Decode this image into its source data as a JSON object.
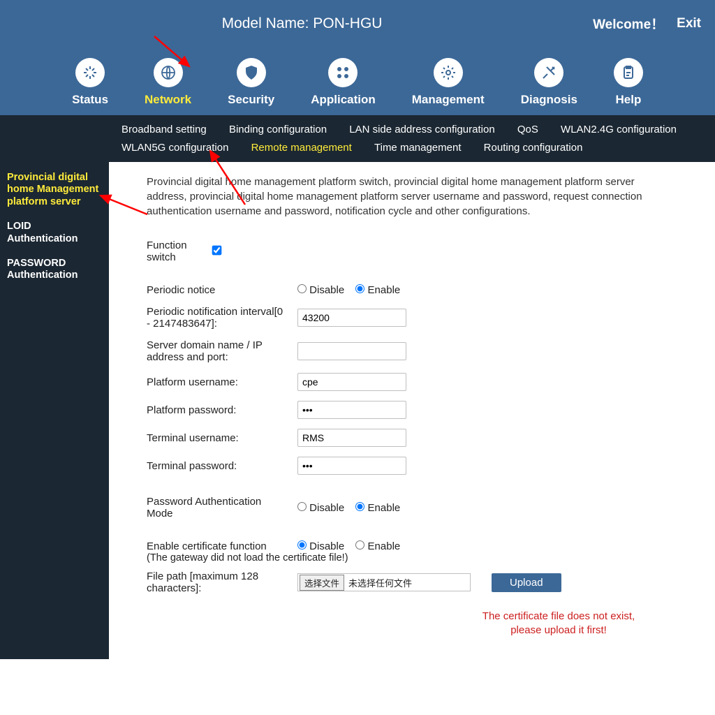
{
  "header": {
    "model_label": "Model Name: PON-HGU",
    "welcome": "Welcome！",
    "exit": "Exit"
  },
  "mainnav": [
    {
      "id": "status",
      "label": "Status"
    },
    {
      "id": "network",
      "label": "Network",
      "active": true
    },
    {
      "id": "security",
      "label": "Security"
    },
    {
      "id": "application",
      "label": "Application"
    },
    {
      "id": "management",
      "label": "Management"
    },
    {
      "id": "diagnosis",
      "label": "Diagnosis"
    },
    {
      "id": "help",
      "label": "Help"
    }
  ],
  "subnav": [
    {
      "label": "Broadband setting"
    },
    {
      "label": "Binding configuration"
    },
    {
      "label": "LAN side address configuration"
    },
    {
      "label": "QoS"
    },
    {
      "label": "WLAN2.4G configuration"
    },
    {
      "label": "WLAN5G configuration"
    },
    {
      "label": "Remote management",
      "active": true
    },
    {
      "label": "Time management"
    },
    {
      "label": "Routing configuration"
    }
  ],
  "sidebar": [
    {
      "label": "Provincial digital home Management platform server",
      "active": true
    },
    {
      "label": "LOID Authentication"
    },
    {
      "label": "PASSWORD Authentication"
    }
  ],
  "main": {
    "description": "Provincial digital home management platform switch, provincial digital home management platform server address, provincial digital home management platform server username and password, request connection authentication username and password, notification cycle and other configurations.",
    "function_switch_label": "Function switch",
    "function_switch_checked": true,
    "periodic_notice_label": "Periodic notice",
    "disable_text": "Disable",
    "enable_text": "Enable",
    "periodic_notice_value": "enable",
    "interval_label": "Periodic notification interval[0 - 2147483647]:",
    "interval_value": "43200",
    "server_label": "Server domain name / IP address and port:",
    "server_value": "",
    "platform_user_label": "Platform username:",
    "platform_user_value": "cpe",
    "platform_pass_label": "Platform password:",
    "platform_pass_value": "•••",
    "terminal_user_label": "Terminal username:",
    "terminal_user_value": "RMS",
    "terminal_pass_label": "Terminal password:",
    "terminal_pass_value": "•••",
    "pwd_auth_label": "Password Authentication Mode",
    "pwd_auth_value": "enable",
    "cert_label": "Enable certificate function",
    "cert_value": "disable",
    "cert_note": "(The gateway did not load the certificate file!)",
    "file_label": "File path [maximum 128 characters]:",
    "file_choose": "选择文件",
    "file_none": "未选择任何文件",
    "upload": "Upload",
    "cert_warning": "The certificate file does not exist, please upload it first!"
  }
}
